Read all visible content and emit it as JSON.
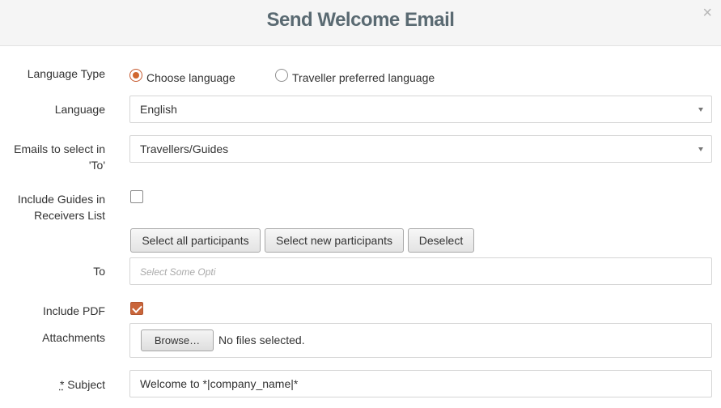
{
  "modal": {
    "title": "Send Welcome Email",
    "close_glyph": "×"
  },
  "language_type": {
    "label": "Language Type",
    "options": [
      {
        "label": "Choose language",
        "selected": true
      },
      {
        "label": "Traveller preferred language",
        "selected": false
      }
    ]
  },
  "language": {
    "label": "Language",
    "value": "English"
  },
  "emails_to": {
    "label_line1": "Emails to select in",
    "label_line2": "'To'",
    "value": "Travellers/Guides"
  },
  "include_guides": {
    "label_line1": "Include Guides in",
    "label_line2": "Receivers List",
    "checked": false
  },
  "participant_buttons": {
    "select_all": "Select all participants",
    "select_new": "Select new participants",
    "deselect": "Deselect"
  },
  "to_field": {
    "label": "To",
    "placeholder": "Select Some Opti"
  },
  "include_pdf": {
    "label": "Include PDF",
    "checked": true
  },
  "attachments": {
    "label": "Attachments",
    "browse_label": "Browse…",
    "status": "No files selected."
  },
  "subject": {
    "required_mark": "*",
    "label": "Subject",
    "value": "Welcome to *|company_name|*"
  },
  "colors": {
    "accent": "#d0672f",
    "title": "#5a6a72",
    "header_bg": "#f5f5f5"
  },
  "icons": [
    "close-icon",
    "chevron-down-icon",
    "check-icon"
  ]
}
